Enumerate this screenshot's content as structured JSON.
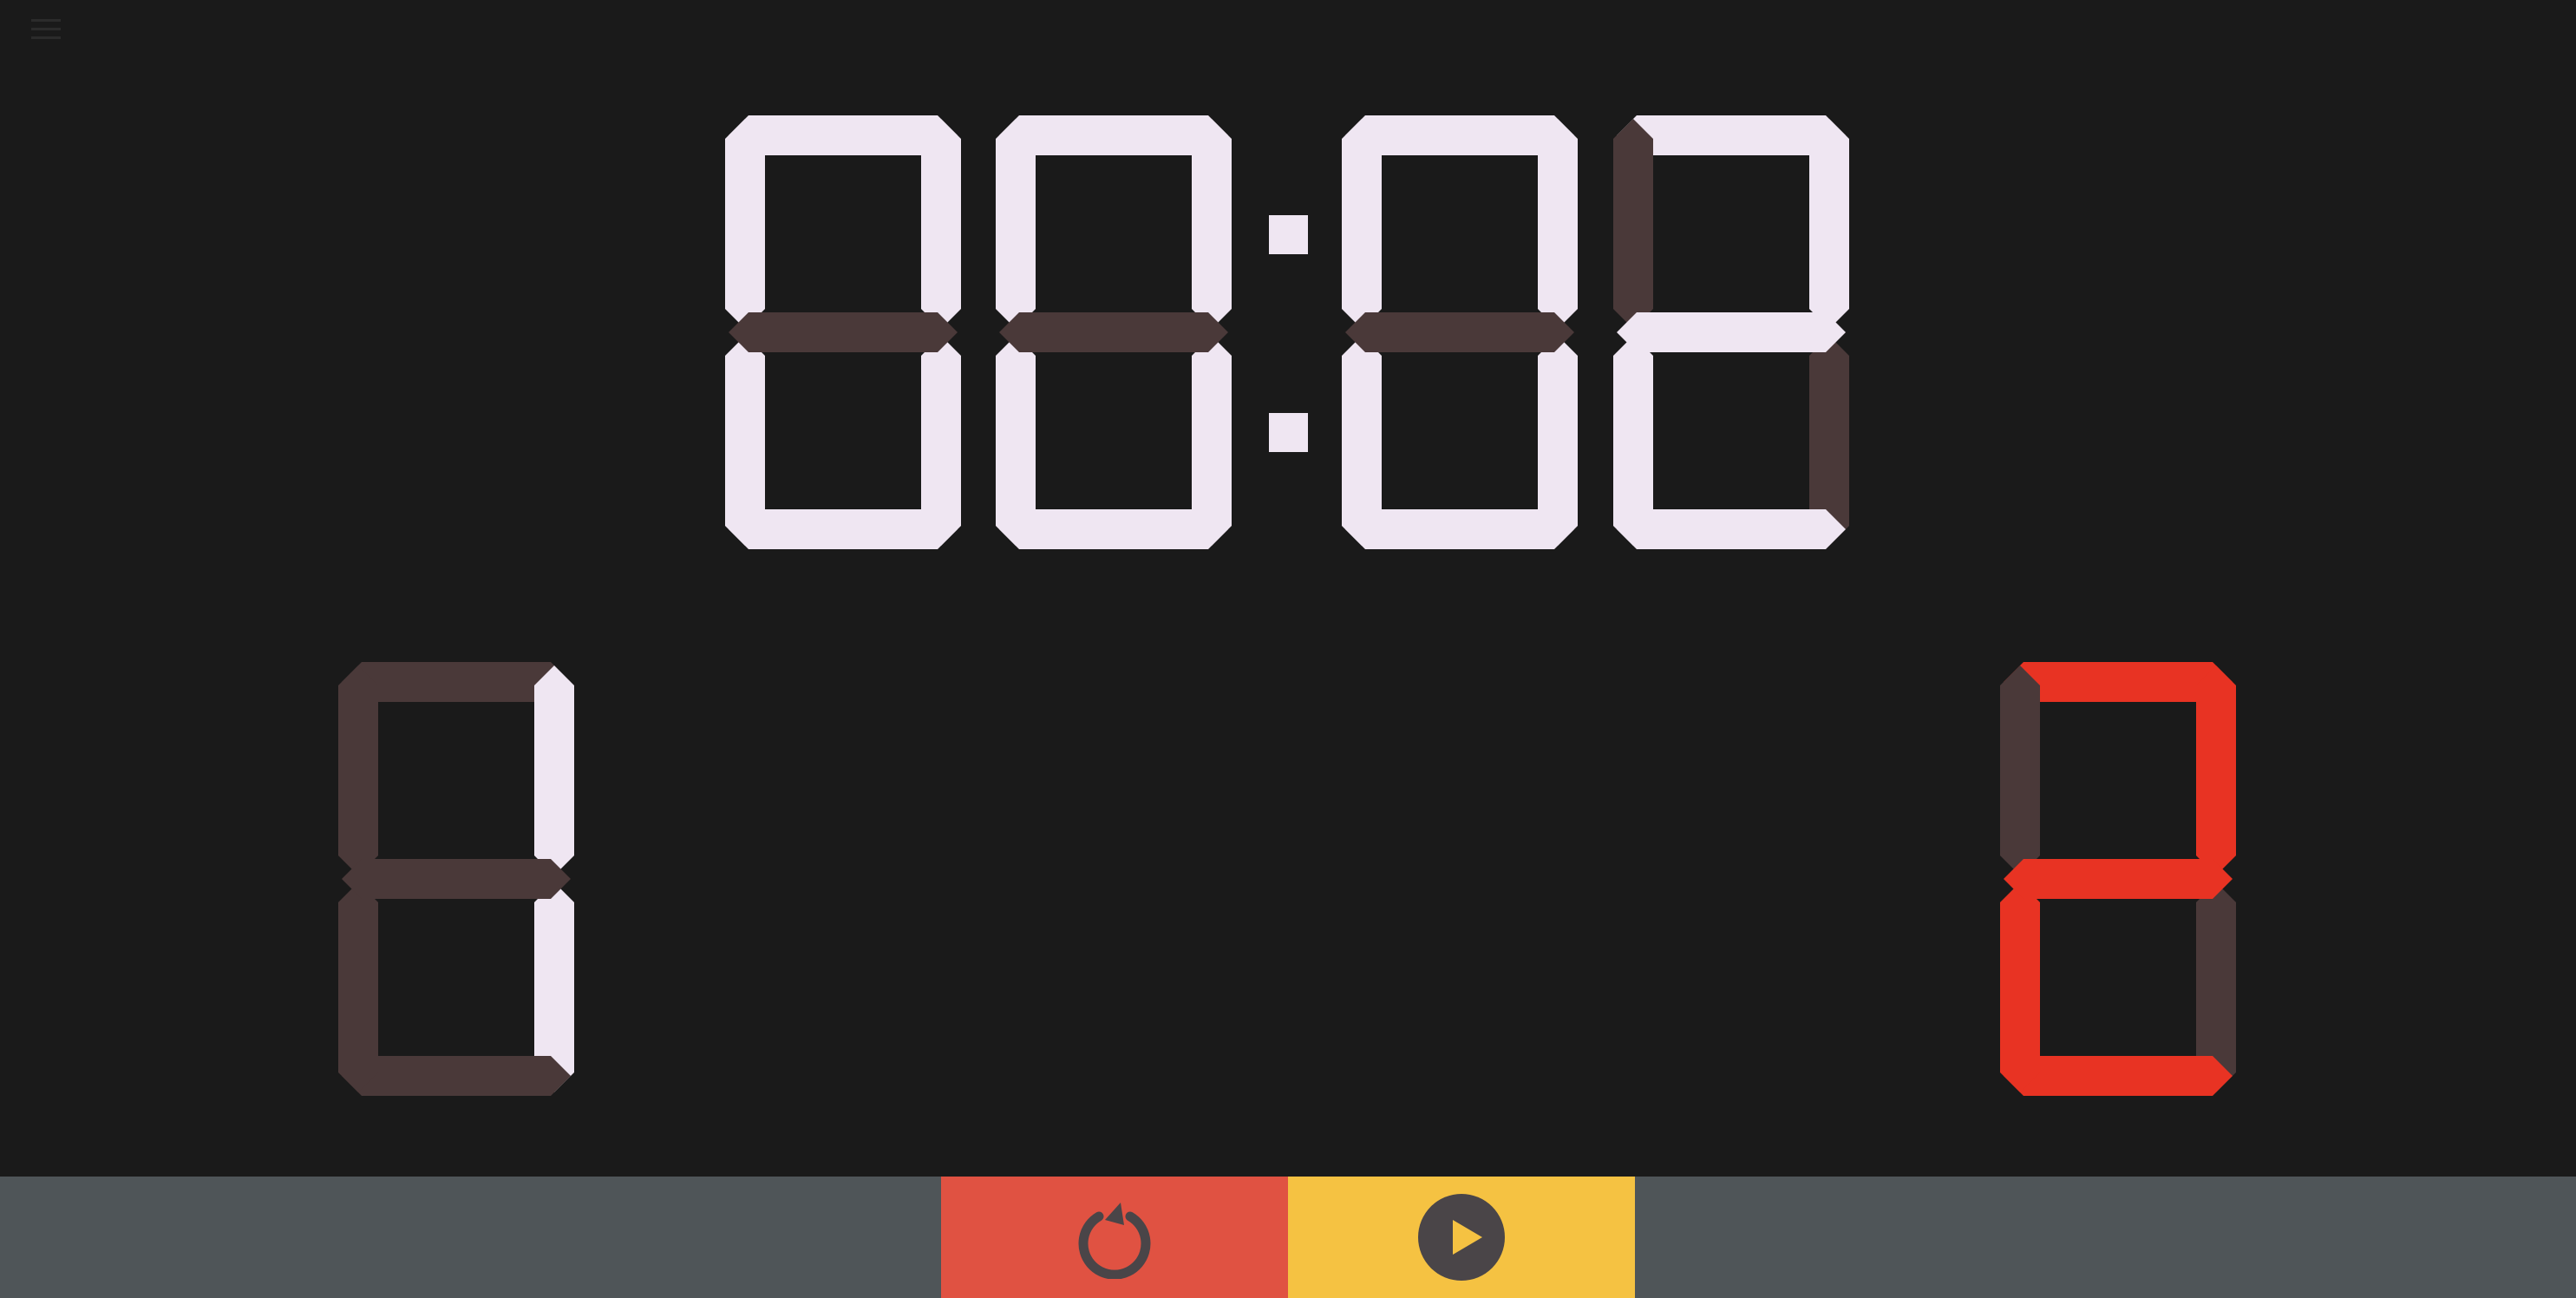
{
  "clock": {
    "minutes": "00",
    "seconds": "02"
  },
  "score": {
    "left": "1",
    "right": "2"
  },
  "controls": {
    "reset_icon": "reset-icon",
    "play_icon": "play-icon",
    "menu_icon": "hamburger-menu-icon"
  },
  "colors": {
    "background": "#1a1a1a",
    "segment_on_white": "#efe6f2",
    "segment_on_red": "#e83323",
    "segment_off": "#4a3939",
    "bottom_bar": "#4f5558",
    "reset_button": "#e05242",
    "play_button": "#f5c242",
    "icon_dark": "#4a4548"
  }
}
